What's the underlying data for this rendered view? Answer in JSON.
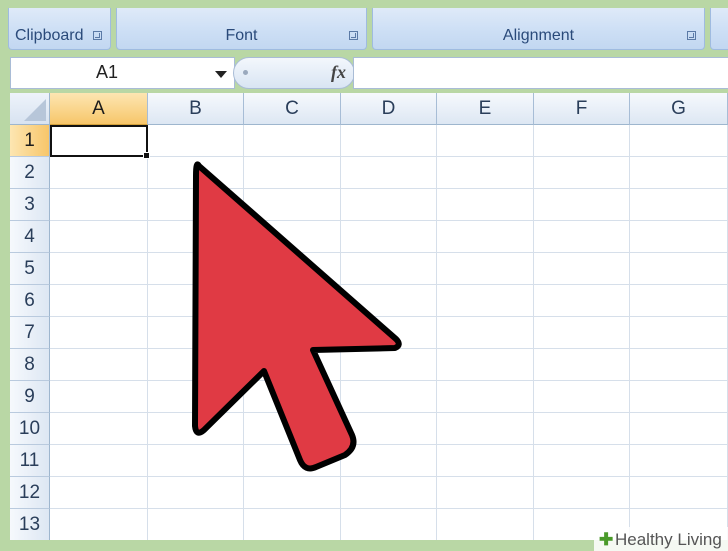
{
  "ribbon": {
    "groups": [
      {
        "label": "Clipboard",
        "launcher_icon": "dialog-launcher-icon"
      },
      {
        "label": "Font",
        "launcher_icon": "dialog-launcher-icon"
      },
      {
        "label": "Alignment",
        "launcher_icon": "dialog-launcher-icon"
      }
    ]
  },
  "formula_bar": {
    "name_box": "A1",
    "fx_label": "fx",
    "formula_value": ""
  },
  "sheet": {
    "columns": [
      "A",
      "B",
      "C",
      "D",
      "E",
      "F",
      "G"
    ],
    "rows": [
      "1",
      "2",
      "3",
      "4",
      "5",
      "6",
      "7",
      "8",
      "9",
      "10",
      "11",
      "12",
      "13"
    ],
    "selected_column": "A",
    "selected_row": "1",
    "active_cell": "A1"
  },
  "overlay": {
    "pointer_icon": "arrow-pointer-icon",
    "pointer_color": "#e03a44"
  },
  "watermark": {
    "text": "Healthy Living"
  },
  "colors": {
    "background": "#b9d7a5",
    "selected_header": "#f7c66a",
    "ribbon": "#cddff5"
  }
}
